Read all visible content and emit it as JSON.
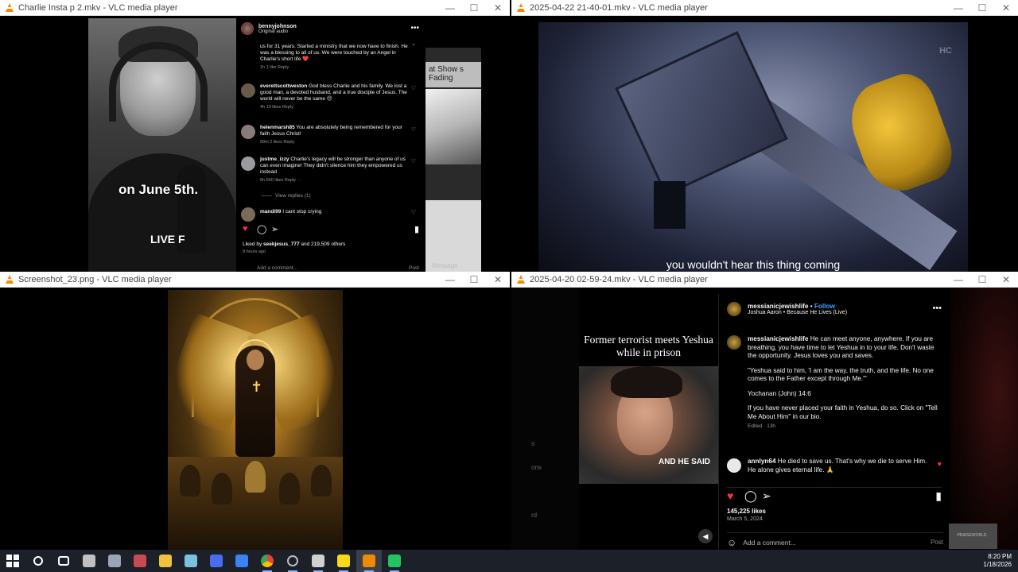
{
  "windows": [
    {
      "title": "Charlie Insta p 2.mkv - VLC media player"
    },
    {
      "title": "2025-04-22 21-40-01.mkv - VLC media player"
    },
    {
      "title": "Screenshot_23.png - VLC media player"
    },
    {
      "title": "2025-04-20 02-59-24.mkv - VLC media player"
    }
  ],
  "window_controls": {
    "minimize": "—",
    "maximize": "☐",
    "close": "✕"
  },
  "w1": {
    "video_caption": "on June 5th.",
    "video_caption2": "LIVE F",
    "side_thumb_text": "at Show s Fading",
    "side_message": "Message",
    "post_user": "bennyjohnson",
    "post_audio": "Original audio",
    "comments": [
      {
        "user": "",
        "text": "us for 31 years. Started a ministry that we now have to finish. He was a blessing to all of us. We were touched by an Angel in Charlie's short life ❤️",
        "meta": "1h   1 like   Reply"
      },
      {
        "user": "everettscottweston",
        "text": "God bless Charlie and his family. We lost a good man, a devoted husband, and a true disciple of Jesus. The world will never be the same 😔",
        "meta": "4h   10 likes   Reply"
      },
      {
        "user": "helenmarsh85",
        "text": "You are absolutely being remembered for your faith Jesus Christ!",
        "meta": "59m   2 likes   Reply"
      },
      {
        "user": "justme_izzy",
        "text": "Charlie's legacy will be stronger than anyone of us can even imagine! They didn't silence him they empowered us instead",
        "meta": "5h   660 likes   Reply   ···"
      },
      {
        "user": "mandi99",
        "text": "I cant stop crying",
        "meta": ""
      }
    ],
    "view_replies": "View replies (1)",
    "liked_by": "Liked by",
    "liked_user": "seekjesus_777",
    "liked_rest": "and 219,509 others",
    "time_ago": "9 hours ago",
    "add_comment": "Add a comment...",
    "post_label": "Post"
  },
  "w2": {
    "subtitle": "you wouldn't hear this thing coming",
    "logo": "HC"
  },
  "w4": {
    "left_letters": [
      "s",
      "ons",
      "rd"
    ],
    "video_title": "Former terrorist meets Yeshua while in prison",
    "video_caption": "AND HE SAID",
    "account": "messianicjewishlife",
    "follow": "Follow",
    "audio": "Joshua Aaron • Because He Lives (Live)",
    "caption_user": "messianicjewishlife",
    "caption_p1": "He can meet anyone, anywhere. If you are breathing, you have time to let Yeshua in to your life. Don't waste the opportunity. Jesus loves you and saves.",
    "caption_p2": "\"Yeshua said to him, 'I am the way, the truth, and the life. No one comes to the Father except through Me.'\"",
    "caption_p3": "Yochanan (John) 14:6",
    "caption_p4": "If you have never placed your faith in Yeshua, do so. Click on \"Tell Me About Him\" in our bio.",
    "edited": "Edited · 13h",
    "comment_user": "annlyn64",
    "comment_text": "He died to save us. That's why we die to serve Him. He alone gives eternal life. 🙏",
    "likes": "145,225 likes",
    "date": "March 5, 2024",
    "add_comment": "Add a comment...",
    "post_label": "Post",
    "watermark": "PRAISEWORLD"
  },
  "taskbar": {
    "time": "8:20 PM",
    "date": "1/18/2026",
    "apps": [
      {
        "name": "start-icon",
        "color": "#ffffff"
      },
      {
        "name": "search-icon",
        "color": "#ffffff"
      },
      {
        "name": "task-view-icon",
        "color": "#ffffff"
      },
      {
        "name": "app-icon-1",
        "color": "#c0c0c0"
      },
      {
        "name": "app-icon-2",
        "color": "#9aa4b8"
      },
      {
        "name": "app-icon-3",
        "color": "#c74b50"
      },
      {
        "name": "file-explorer-icon",
        "color": "#f2c23a"
      },
      {
        "name": "app-icon-4",
        "color": "#7ac0e0"
      },
      {
        "name": "app-icon-5",
        "color": "#4a6cf0"
      },
      {
        "name": "app-icon-6",
        "color": "#3b82f6"
      },
      {
        "name": "chrome-icon",
        "color": "#34a853"
      },
      {
        "name": "nvidia-icon",
        "color": "#76b900"
      },
      {
        "name": "app-icon-7",
        "color": "#d0d0d0"
      },
      {
        "name": "sticky-notes-icon",
        "color": "#f7d917"
      },
      {
        "name": "vlc-icon",
        "color": "#f08a00"
      },
      {
        "name": "app-icon-8",
        "color": "#22c55e"
      }
    ]
  }
}
